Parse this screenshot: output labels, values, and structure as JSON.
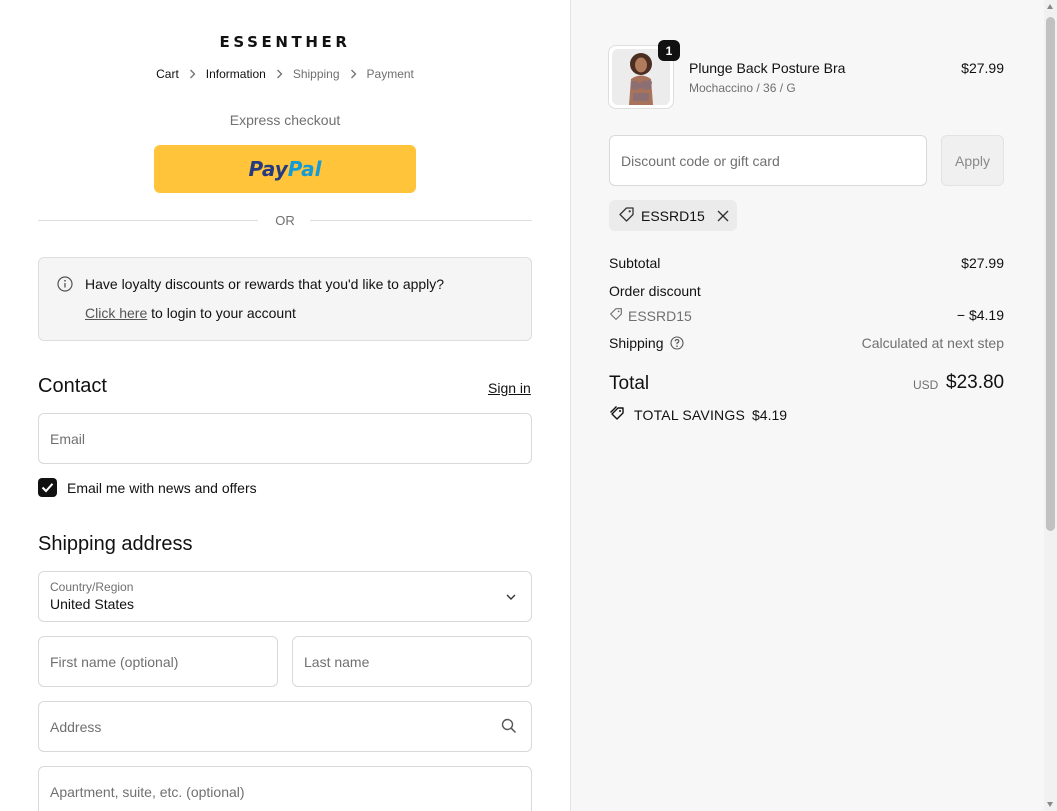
{
  "brand": {
    "logo_text": "ESSENTHER"
  },
  "breadcrumb": [
    {
      "label": "Cart",
      "state": "link"
    },
    {
      "label": "Information",
      "state": "current"
    },
    {
      "label": "Shipping",
      "state": "upcoming"
    },
    {
      "label": "Payment",
      "state": "upcoming"
    }
  ],
  "express": {
    "title": "Express checkout",
    "paypal_pay": "Pay",
    "paypal_pal": "Pal",
    "divider": "OR"
  },
  "loyalty": {
    "message": "Have loyalty discounts or rewards that you'd like to apply?",
    "link": "Click here",
    "link_suffix": " to login to your account"
  },
  "contact": {
    "heading": "Contact",
    "sign_in": "Sign in",
    "email_placeholder": "Email",
    "newsletter_label": "Email me with news and offers",
    "newsletter_checked": true
  },
  "shipping": {
    "heading": "Shipping address",
    "country_label": "Country/Region",
    "country_value": "United States",
    "first_name_placeholder": "First name (optional)",
    "last_name_placeholder": "Last name",
    "address_placeholder": "Address",
    "apartment_placeholder": "Apartment, suite, etc. (optional)"
  },
  "order": {
    "item": {
      "name": "Plunge Back Posture Bra",
      "variant": "Mochaccino / 36 / G",
      "price": "$27.99",
      "quantity": "1"
    },
    "discount_placeholder": "Discount code or gift card",
    "apply_label": "Apply",
    "applied_code": "ESSRD15",
    "subtotal_label": "Subtotal",
    "subtotal_value": "$27.99",
    "order_discount_label": "Order discount",
    "discount_code": "ESSRD15",
    "discount_value": "− $4.19",
    "shipping_label": "Shipping",
    "shipping_value": "Calculated at next step",
    "total_label": "Total",
    "currency": "USD",
    "total_value": "$23.80",
    "savings_label": "TOTAL SAVINGS",
    "savings_value": "$4.19"
  },
  "colors": {
    "paypal_yellow": "#ffc439",
    "paypal_dark_blue": "#253b80",
    "paypal_light_blue": "#179bd7",
    "right_panel_bg": "#f7f7f7"
  }
}
